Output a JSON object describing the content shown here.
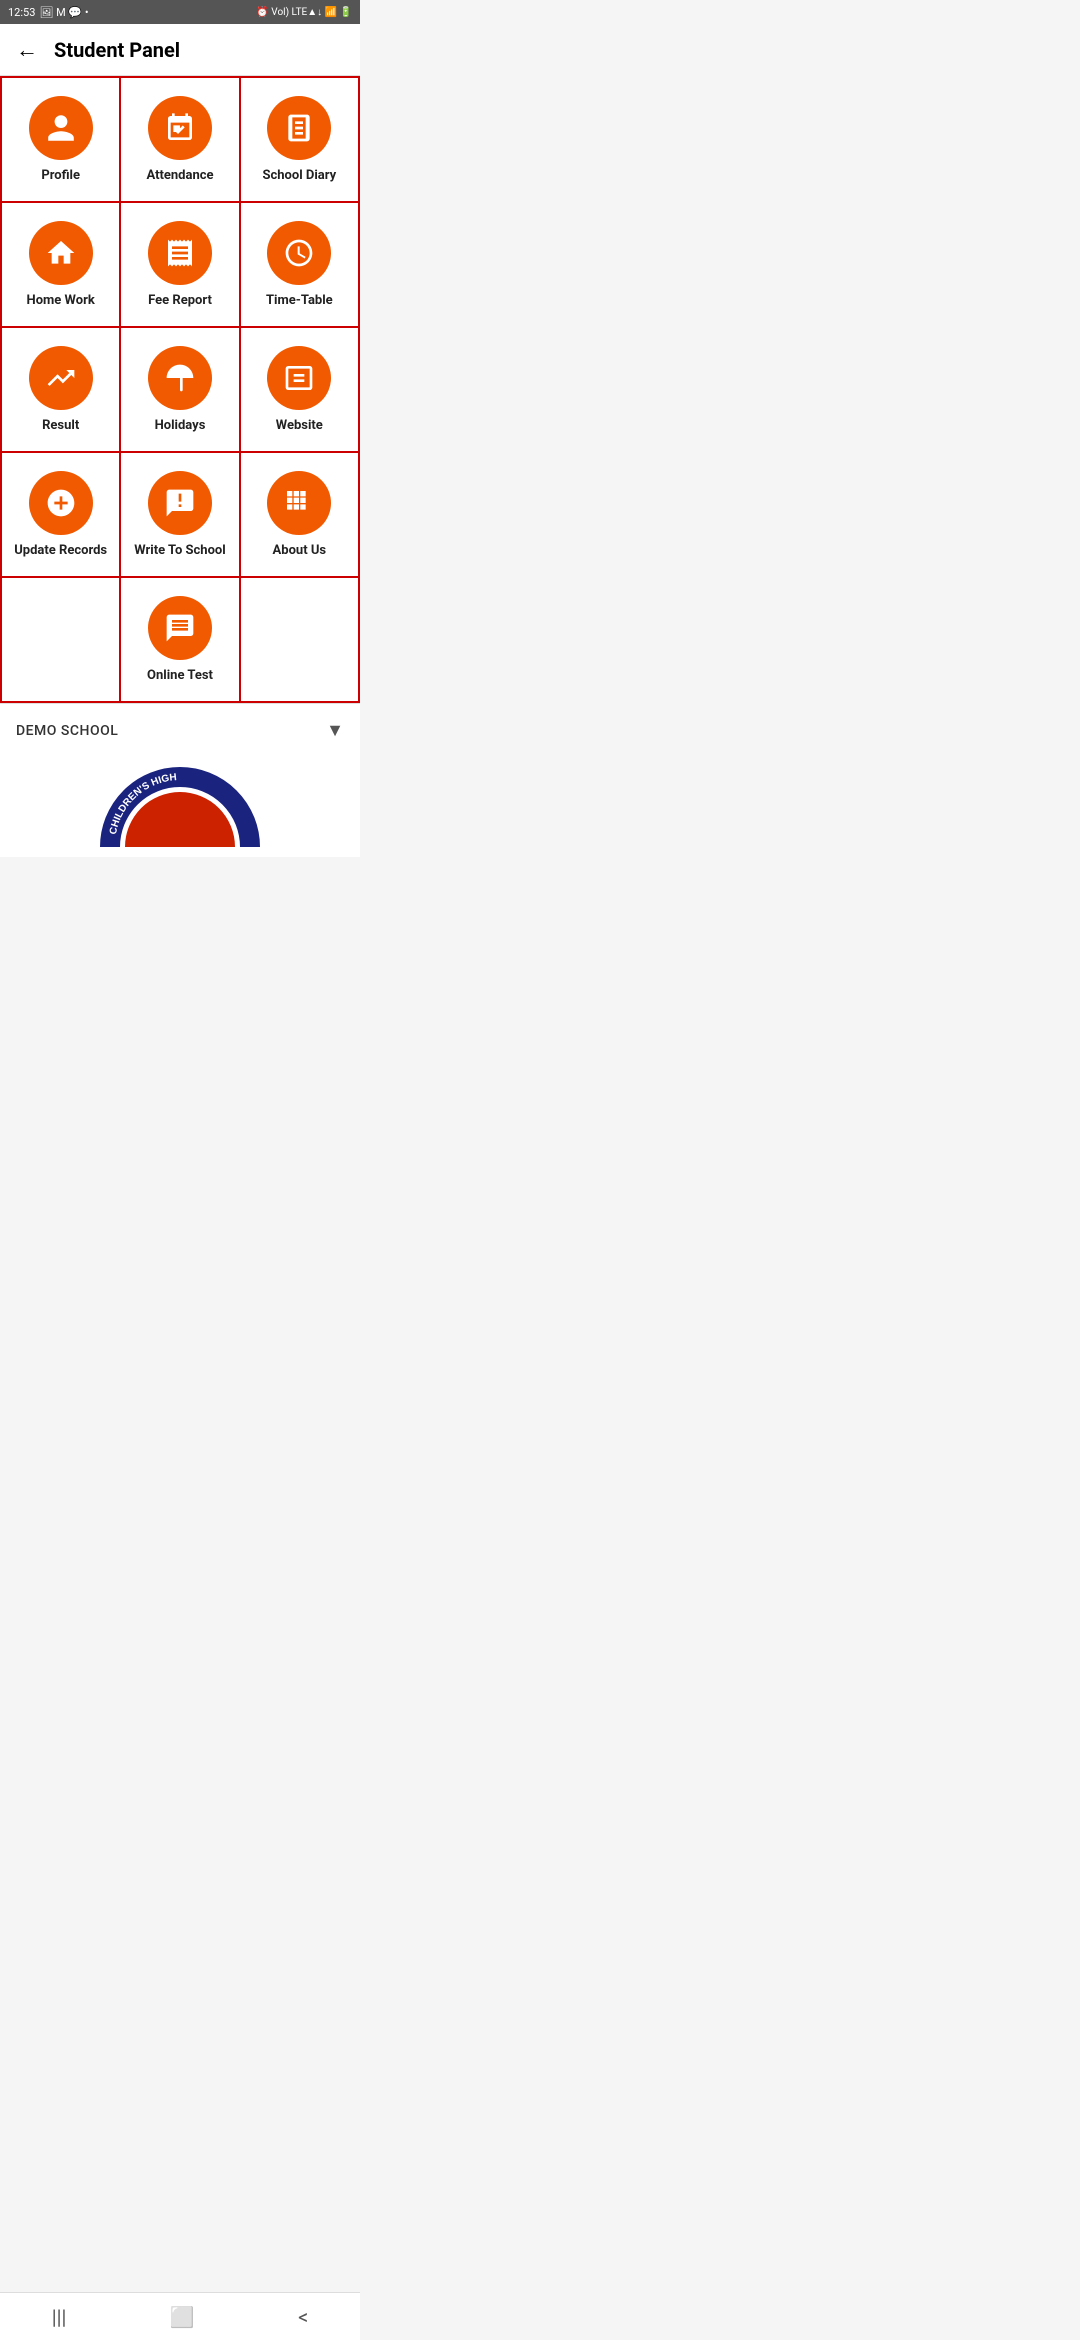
{
  "statusBar": {
    "time": "12:53",
    "rightIcons": "⏰ Vol LTE ▲▼ 🔋"
  },
  "header": {
    "backLabel": "←",
    "title": "Student Panel"
  },
  "grid": {
    "rows": [
      [
        {
          "id": "profile",
          "label": "Profile",
          "icon": "person"
        },
        {
          "id": "attendance",
          "label": "Attendance",
          "icon": "calendar-check"
        },
        {
          "id": "school-diary",
          "label": "School Diary",
          "icon": "book"
        }
      ],
      [
        {
          "id": "home-work",
          "label": "Home Work",
          "icon": "home"
        },
        {
          "id": "fee-report",
          "label": "Fee Report",
          "icon": "receipt"
        },
        {
          "id": "time-table",
          "label": "Time-Table",
          "icon": "clock"
        }
      ],
      [
        {
          "id": "result",
          "label": "Result",
          "icon": "trending-up"
        },
        {
          "id": "holidays",
          "label": "Holidays",
          "icon": "umbrella"
        },
        {
          "id": "website",
          "label": "Website",
          "icon": "web"
        }
      ],
      [
        {
          "id": "update-records",
          "label": "Update Records",
          "icon": "plus-circle"
        },
        {
          "id": "write-to-school",
          "label": "Write To School",
          "icon": "message-alert"
        },
        {
          "id": "about-us",
          "label": "About Us",
          "icon": "grid"
        }
      ],
      [
        {
          "id": "empty-left",
          "label": "",
          "icon": ""
        },
        {
          "id": "online-test",
          "label": "Online Test",
          "icon": "chat"
        },
        {
          "id": "empty-right",
          "label": "",
          "icon": ""
        }
      ]
    ]
  },
  "footer": {
    "schoolName": "DEMO SCHOOL",
    "dropdownArrow": "▼"
  },
  "bottomNav": {
    "menuIcon": "|||",
    "homeIcon": "☐",
    "backIcon": "<"
  }
}
